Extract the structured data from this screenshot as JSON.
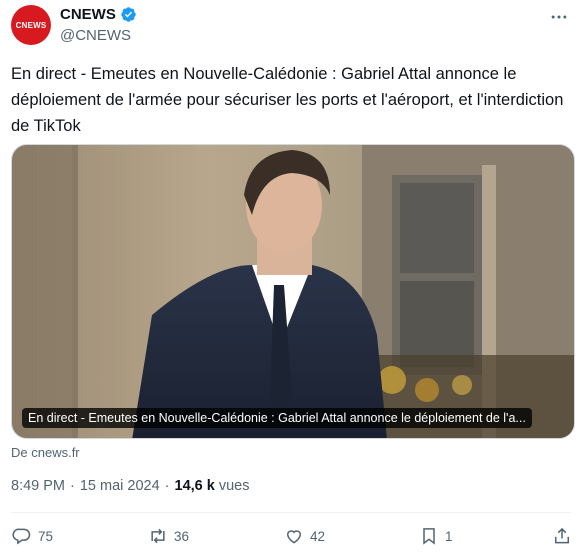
{
  "author": {
    "avatar_text": "CNEWS",
    "display_name": "CNEWS",
    "handle": "@CNEWS",
    "verified": true
  },
  "tweet": {
    "text": "En direct - Emeutes en Nouvelle-Calédonie : Gabriel Attal annonce le déploiement de l'armée pour sécuriser les ports et l'aéroport, et l'interdiction de TikTok"
  },
  "card": {
    "caption": "En direct - Emeutes en Nouvelle-Calédonie : Gabriel Attal annonce le déploiement de l'a...",
    "source": "De cnews.fr"
  },
  "meta": {
    "time": "8:49 PM",
    "date": "15 mai 2024",
    "separator": "·",
    "views_count": "14,6 k",
    "views_label": "vues"
  },
  "actions": {
    "replies": "75",
    "reposts": "36",
    "likes": "42",
    "bookmarks": "1"
  },
  "colors": {
    "brand": "#d71920",
    "verified": "#1d9bf0",
    "muted": "#536471"
  },
  "icons": [
    "verified-icon",
    "more-icon",
    "reply-icon",
    "repost-icon",
    "like-icon",
    "bookmark-icon",
    "share-icon"
  ]
}
